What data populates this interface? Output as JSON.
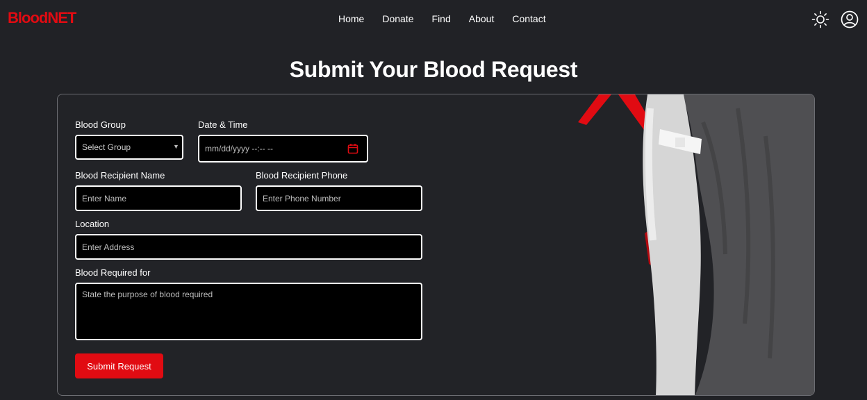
{
  "brand": {
    "logo_text": "BloodNET",
    "accent_color": "#e10b12"
  },
  "nav": {
    "items": [
      {
        "label": "Home"
      },
      {
        "label": "Donate"
      },
      {
        "label": "Find"
      },
      {
        "label": "About"
      },
      {
        "label": "Contact"
      }
    ],
    "theme_toggle_icon": "sun-icon",
    "profile_icon": "user-circle-icon"
  },
  "page": {
    "title": "Submit Your Blood Request"
  },
  "form": {
    "blood_group": {
      "label": "Blood Group",
      "placeholder": "Select Group"
    },
    "date_time": {
      "label": "Date & Time",
      "placeholder": "mm/dd/yyyy --:-- --"
    },
    "recipient_name": {
      "label": "Blood Recipient Name",
      "placeholder": "Enter Name"
    },
    "recipient_phone": {
      "label": "Blood Recipient Phone",
      "placeholder": "Enter Phone Number"
    },
    "location": {
      "label": "Location",
      "placeholder": "Enter Address"
    },
    "purpose": {
      "label": "Blood Required for",
      "placeholder": "State the purpose of blood required"
    },
    "submit_label": "Submit Request"
  }
}
